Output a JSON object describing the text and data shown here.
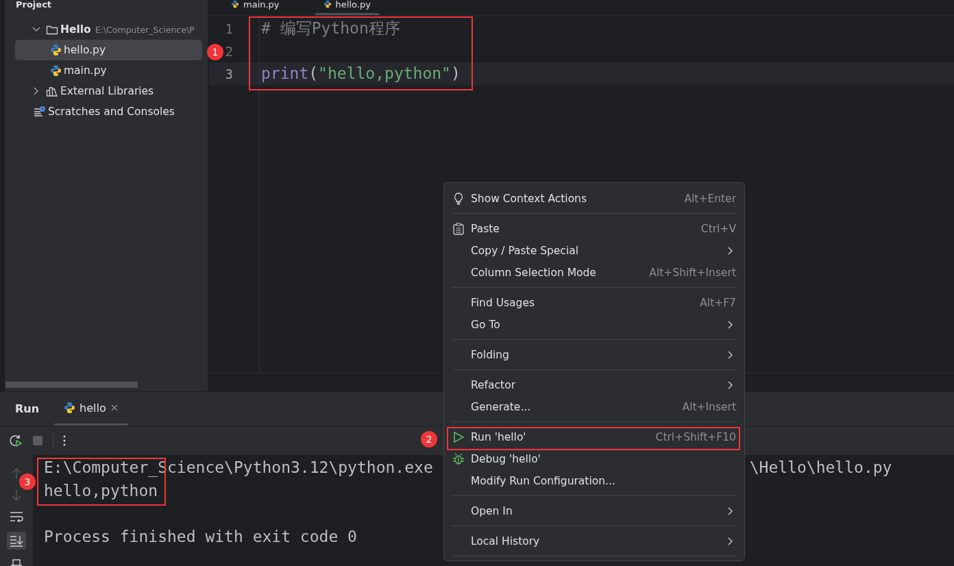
{
  "sidebar": {
    "title": "Project",
    "tree": [
      {
        "label": "Hello",
        "path": "E:\\Computer_Science\\P",
        "kind": "folder",
        "expanded": true,
        "selected": false,
        "children": [
          {
            "label": "hello.py",
            "kind": "python",
            "selected": true
          },
          {
            "label": "main.py",
            "kind": "python",
            "selected": false
          }
        ]
      },
      {
        "label": "External Libraries",
        "kind": "library",
        "expanded": false,
        "selected": false
      },
      {
        "label": "Scratches and Consoles",
        "kind": "scratches",
        "selected": false
      }
    ]
  },
  "editor": {
    "tabs": [
      {
        "label": "main.py",
        "selected": false
      },
      {
        "label": "hello.py",
        "selected": true
      }
    ],
    "lines": [
      {
        "number": "1",
        "current": false,
        "tokens": [
          {
            "text": "# 编写Python程序",
            "kind": "comment"
          }
        ]
      },
      {
        "number": "2",
        "current": false
      },
      {
        "number": "3",
        "current": true,
        "tokens": [
          {
            "text": "print",
            "kind": "builtin"
          },
          {
            "text": "(",
            "kind": "punct"
          },
          {
            "text": "\"hello,python\"",
            "kind": "string"
          },
          {
            "text": ")",
            "kind": "punct"
          }
        ]
      }
    ]
  },
  "context_menu": [
    {
      "kind": "item",
      "label": "Show Context Actions",
      "shortcut": "Alt+Enter",
      "submenu": false
    },
    {
      "kind": "separator"
    },
    {
      "kind": "item",
      "label": "Paste",
      "shortcut": "Ctrl+V",
      "submenu": false
    },
    {
      "kind": "item",
      "label": "Copy / Paste Special",
      "submenu": true
    },
    {
      "kind": "item",
      "label": "Column Selection Mode",
      "shortcut": "Alt+Shift+Insert",
      "submenu": false
    },
    {
      "kind": "separator"
    },
    {
      "kind": "item",
      "label": "Find Usages",
      "shortcut": "Alt+F7",
      "submenu": false
    },
    {
      "kind": "item",
      "label": "Go To",
      "submenu": true
    },
    {
      "kind": "separator"
    },
    {
      "kind": "item",
      "label": "Folding",
      "submenu": true
    },
    {
      "kind": "separator"
    },
    {
      "kind": "item",
      "label": "Refactor",
      "submenu": true
    },
    {
      "kind": "item",
      "label": "Generate...",
      "shortcut": "Alt+Insert",
      "submenu": false
    },
    {
      "kind": "separator"
    },
    {
      "kind": "item",
      "label": "Run 'hello'",
      "shortcut": "Ctrl+Shift+F10",
      "submenu": false
    },
    {
      "kind": "item",
      "label": "Debug 'hello'",
      "submenu": false
    },
    {
      "kind": "item",
      "label": "Modify Run Configuration...",
      "submenu": false
    },
    {
      "kind": "separator"
    },
    {
      "kind": "item",
      "label": "Open In",
      "submenu": true
    },
    {
      "kind": "separator"
    },
    {
      "kind": "item",
      "label": "Local History",
      "submenu": true
    },
    {
      "kind": "separator"
    }
  ],
  "run_panel": {
    "title": "Run",
    "tabs": [
      {
        "label": "hello",
        "selected": true
      }
    ],
    "console": [
      {
        "kind": "split",
        "left": "E:\\Computer_Science\\Python3.12\\python.exe",
        "right": "\\Hello\\hello.py"
      },
      {
        "kind": "output",
        "text": "hello,python"
      },
      {
        "kind": "blank"
      },
      {
        "kind": "output",
        "text": "Process finished with exit code 0"
      }
    ]
  },
  "annotations": [
    {
      "number": "1"
    },
    {
      "number": "2"
    },
    {
      "number": "3"
    }
  ]
}
